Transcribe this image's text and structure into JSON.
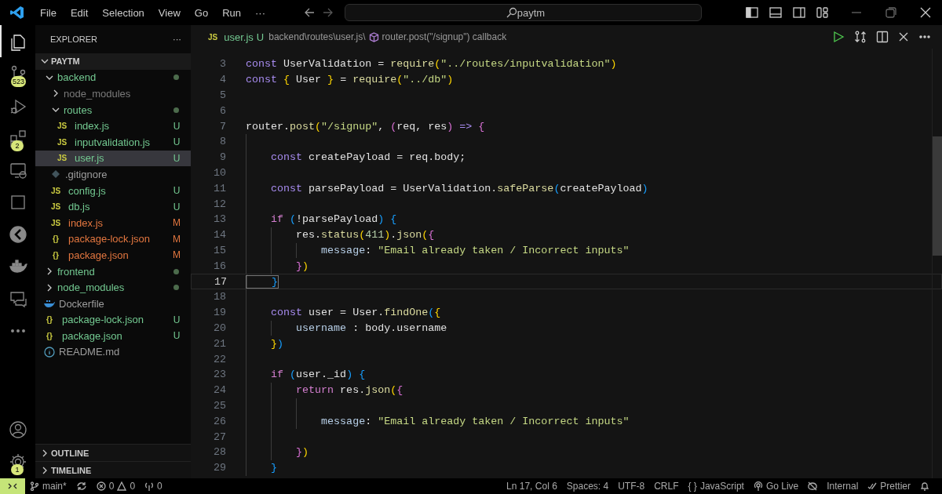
{
  "title_bar": {
    "menus": [
      "File",
      "Edit",
      "Selection",
      "View",
      "Go",
      "Run"
    ],
    "overflow": "···",
    "search": {
      "value": "paytm"
    }
  },
  "activity_bar": {
    "top": [
      {
        "kind": "files",
        "selected": true
      },
      {
        "kind": "source-control",
        "selected": false,
        "badge": "523"
      },
      {
        "kind": "run",
        "selected": false
      },
      {
        "kind": "extensions",
        "selected": false,
        "badge": "2"
      },
      {
        "kind": "remote",
        "selected": false
      },
      {
        "kind": "square",
        "selected": false
      },
      {
        "kind": "gauge",
        "selected": false
      },
      {
        "kind": "docker",
        "selected": false
      },
      {
        "kind": "chat",
        "selected": false
      },
      {
        "kind": "more",
        "selected": false
      }
    ],
    "bottom": [
      {
        "kind": "account",
        "selected": false
      },
      {
        "kind": "settings",
        "selected": false,
        "badge": "1"
      }
    ]
  },
  "sidebar": {
    "title": "EXPLORER",
    "more": "···",
    "root": {
      "label": "PAYTM",
      "expanded": true
    },
    "tree": [
      {
        "label": "backend",
        "kind": "folder",
        "expanded": true,
        "color": "#73c991",
        "dot": true,
        "selected": false,
        "children": [
          {
            "label": "node_modules",
            "kind": "folder",
            "expanded": false,
            "color": "#7a7a7a",
            "dot": false,
            "selected": false
          },
          {
            "label": "routes",
            "kind": "folder",
            "expanded": true,
            "color": "#73c991",
            "dot": true,
            "selected": false,
            "children": [
              {
                "label": "index.js",
                "kind": "file",
                "icon": "JS",
                "color": "#73c991",
                "badge": "U",
                "selected": false
              },
              {
                "label": "inputvalidation.js",
                "kind": "file",
                "icon": "JS",
                "color": "#73c991",
                "badge": "U",
                "selected": false
              },
              {
                "label": "user.js",
                "kind": "file",
                "icon": "JS",
                "color": "#73c991",
                "badge": "U",
                "selected": true
              }
            ]
          },
          {
            "label": ".gitignore",
            "kind": "git",
            "color": "#9d9d9d",
            "selected": false
          },
          {
            "label": "config.js",
            "kind": "file",
            "icon": "JS",
            "color": "#73c991",
            "badge": "U",
            "selected": false
          },
          {
            "label": "db.js",
            "kind": "file",
            "icon": "JS",
            "color": "#73c991",
            "badge": "U",
            "selected": false
          },
          {
            "label": "index.js",
            "kind": "file",
            "icon": "JS",
            "color": "#e2763f",
            "badge": "M",
            "selected": false
          },
          {
            "label": "package-lock.json",
            "kind": "file",
            "icon": "{}",
            "color": "#e2763f",
            "badge": "M",
            "selected": false
          },
          {
            "label": "package.json",
            "kind": "file",
            "icon": "{}",
            "color": "#e2763f",
            "badge": "M",
            "selected": false
          }
        ]
      },
      {
        "label": "frontend",
        "kind": "folder",
        "expanded": false,
        "color": "#73c991",
        "dot": true,
        "selected": false
      },
      {
        "label": "node_modules",
        "kind": "folder",
        "expanded": false,
        "color": "#73c991",
        "dot": true,
        "selected": false
      },
      {
        "label": "Dockerfile",
        "kind": "docker",
        "color": "#9d9d9d",
        "selected": false
      },
      {
        "label": "package-lock.json",
        "kind": "file",
        "icon": "{}",
        "color": "#73c991",
        "badge": "U",
        "selected": false
      },
      {
        "label": "package.json",
        "kind": "file",
        "icon": "{}",
        "color": "#73c991",
        "badge": "U",
        "selected": false
      },
      {
        "label": "README.md",
        "kind": "info",
        "color": "#9d9d9d",
        "selected": false
      }
    ],
    "sections": [
      {
        "label": "OUTLINE",
        "expanded": false
      },
      {
        "label": "TIMELINE",
        "expanded": false
      }
    ]
  },
  "editor": {
    "tab": {
      "icon": "JS",
      "name": "user.js",
      "status": "U",
      "path": "backend\\routes\\user.js\\",
      "symbol": "router.post(\"/signup\") callback"
    },
    "lines": [
      {
        "number": "3",
        "current": false,
        "tokens": [
          {
            "text": "const",
            "kind": "keyword"
          },
          {
            "text": " UserValidation = ",
            "kind": "plain"
          },
          {
            "text": "require",
            "kind": "function"
          },
          {
            "text": "(",
            "kind": "bracket1"
          },
          {
            "text": "\"../routes/inputvalidation\"",
            "kind": "string"
          },
          {
            "text": ")",
            "kind": "bracket1"
          }
        ]
      },
      {
        "number": "4",
        "current": false,
        "tokens": [
          {
            "text": "const",
            "kind": "keyword"
          },
          {
            "text": " {",
            "kind": "bracket1"
          },
          {
            "text": " User ",
            "kind": "plain"
          },
          {
            "text": "}",
            "kind": "bracket1"
          },
          {
            "text": " = ",
            "kind": "plain"
          },
          {
            "text": "require",
            "kind": "function"
          },
          {
            "text": "(",
            "kind": "bracket1"
          },
          {
            "text": "\"../db\"",
            "kind": "string"
          },
          {
            "text": ")",
            "kind": "bracket1"
          }
        ]
      },
      {
        "number": "5",
        "current": false
      },
      {
        "number": "6",
        "current": false
      },
      {
        "number": "7",
        "current": false,
        "tokens": [
          {
            "text": "router.",
            "kind": "plain"
          },
          {
            "text": "post",
            "kind": "function"
          },
          {
            "text": "(",
            "kind": "bracket1"
          },
          {
            "text": "\"/signup\"",
            "kind": "string"
          },
          {
            "text": ", ",
            "kind": "plain"
          },
          {
            "text": "(",
            "kind": "bracket2"
          },
          {
            "text": "req, res",
            "kind": "plain"
          },
          {
            "text": ")",
            "kind": "bracket2"
          },
          {
            "text": " =>",
            "kind": "keyword"
          },
          {
            "text": " {",
            "kind": "bracket2"
          }
        ]
      },
      {
        "number": "8",
        "current": false
      },
      {
        "number": "9",
        "current": false,
        "tokens": [
          {
            "text": "    const",
            "kind": "keyword"
          },
          {
            "text": " createPayload = req.body;",
            "kind": "plain"
          }
        ]
      },
      {
        "number": "10",
        "current": false
      },
      {
        "number": "11",
        "current": false,
        "tokens": [
          {
            "text": "    const",
            "kind": "keyword"
          },
          {
            "text": " parsePayload = UserValidation.",
            "kind": "plain"
          },
          {
            "text": "safeParse",
            "kind": "function"
          },
          {
            "text": "(",
            "kind": "bracket3"
          },
          {
            "text": "createPayload",
            "kind": "plain"
          },
          {
            "text": ")",
            "kind": "bracket3"
          }
        ]
      },
      {
        "number": "12",
        "current": false
      },
      {
        "number": "13",
        "current": false,
        "tokens": [
          {
            "text": "    if",
            "kind": "control"
          },
          {
            "text": " (",
            "kind": "bracket3"
          },
          {
            "text": "!parsePayload",
            "kind": "plain"
          },
          {
            "text": ")",
            "kind": "bracket3"
          },
          {
            "text": " {",
            "kind": "bracket3"
          }
        ]
      },
      {
        "number": "14",
        "current": false,
        "tokens": [
          {
            "text": "        res.",
            "kind": "plain"
          },
          {
            "text": "status",
            "kind": "function"
          },
          {
            "text": "(",
            "kind": "bracket1"
          },
          {
            "text": "411",
            "kind": "number"
          },
          {
            "text": ")",
            "kind": "bracket1"
          },
          {
            "text": ".",
            "kind": "plain"
          },
          {
            "text": "json",
            "kind": "function"
          },
          {
            "text": "(",
            "kind": "bracket1"
          },
          {
            "text": "{",
            "kind": "bracket2"
          }
        ]
      },
      {
        "number": "15",
        "current": false,
        "tokens": [
          {
            "text": "            message",
            "kind": "property"
          },
          {
            "text": ": ",
            "kind": "plain"
          },
          {
            "text": "\"Email already taken / Incorrect inputs\"",
            "kind": "string"
          }
        ]
      },
      {
        "number": "16",
        "current": false,
        "tokens": [
          {
            "text": "        }",
            "kind": "bracket2"
          },
          {
            "text": ")",
            "kind": "bracket1"
          }
        ]
      },
      {
        "number": "17",
        "current": true,
        "tokens": [
          {
            "text": "    }",
            "kind": "bracket3"
          }
        ]
      },
      {
        "number": "18",
        "current": false
      },
      {
        "number": "19",
        "current": false,
        "tokens": [
          {
            "text": "    const",
            "kind": "keyword"
          },
          {
            "text": " user = User.",
            "kind": "plain"
          },
          {
            "text": "findOne",
            "kind": "function"
          },
          {
            "text": "(",
            "kind": "bracket3"
          },
          {
            "text": "{",
            "kind": "bracket1"
          }
        ]
      },
      {
        "number": "20",
        "current": false,
        "tokens": [
          {
            "text": "        username",
            "kind": "property"
          },
          {
            "text": " : body.username",
            "kind": "plain"
          }
        ]
      },
      {
        "number": "21",
        "current": false,
        "tokens": [
          {
            "text": "    }",
            "kind": "bracket1"
          },
          {
            "text": ")",
            "kind": "bracket3"
          }
        ]
      },
      {
        "number": "22",
        "current": false
      },
      {
        "number": "23",
        "current": false,
        "tokens": [
          {
            "text": "    if",
            "kind": "control"
          },
          {
            "text": " (",
            "kind": "bracket3"
          },
          {
            "text": "user._id",
            "kind": "plain"
          },
          {
            "text": ")",
            "kind": "bracket3"
          },
          {
            "text": " {",
            "kind": "bracket3"
          }
        ]
      },
      {
        "number": "24",
        "current": false,
        "tokens": [
          {
            "text": "        return",
            "kind": "control"
          },
          {
            "text": " res.",
            "kind": "plain"
          },
          {
            "text": "json",
            "kind": "function"
          },
          {
            "text": "(",
            "kind": "bracket1"
          },
          {
            "text": "{",
            "kind": "bracket2"
          }
        ]
      },
      {
        "number": "25",
        "current": false
      },
      {
        "number": "26",
        "current": false,
        "tokens": [
          {
            "text": "            message",
            "kind": "property"
          },
          {
            "text": ": ",
            "kind": "plain"
          },
          {
            "text": "\"Email already taken / Incorrect inputs\"",
            "kind": "string"
          }
        ]
      },
      {
        "number": "27",
        "current": false
      },
      {
        "number": "28",
        "current": false,
        "tokens": [
          {
            "text": "        }",
            "kind": "bracket2"
          },
          {
            "text": ")",
            "kind": "bracket1"
          }
        ]
      },
      {
        "number": "29",
        "current": false,
        "tokens": [
          {
            "text": "    }",
            "kind": "bracket3"
          }
        ]
      }
    ]
  },
  "status_bar": {
    "branch": "main*",
    "errors": "0",
    "warnings": "0",
    "ports": "0",
    "right": [
      {
        "kind": "text",
        "label": "Ln 17, Col 6"
      },
      {
        "kind": "text",
        "label": "Spaces: 4"
      },
      {
        "kind": "text",
        "label": "UTF-8"
      },
      {
        "kind": "text",
        "label": "CRLF"
      },
      {
        "kind": "language",
        "prefix": "{ }",
        "label": "JavaScript"
      },
      {
        "kind": "live",
        "label": "Go Live"
      },
      {
        "kind": "copilot"
      },
      {
        "kind": "text",
        "label": "Internal"
      },
      {
        "kind": "formatter",
        "label": "Prettier"
      },
      {
        "kind": "notifications"
      }
    ]
  }
}
